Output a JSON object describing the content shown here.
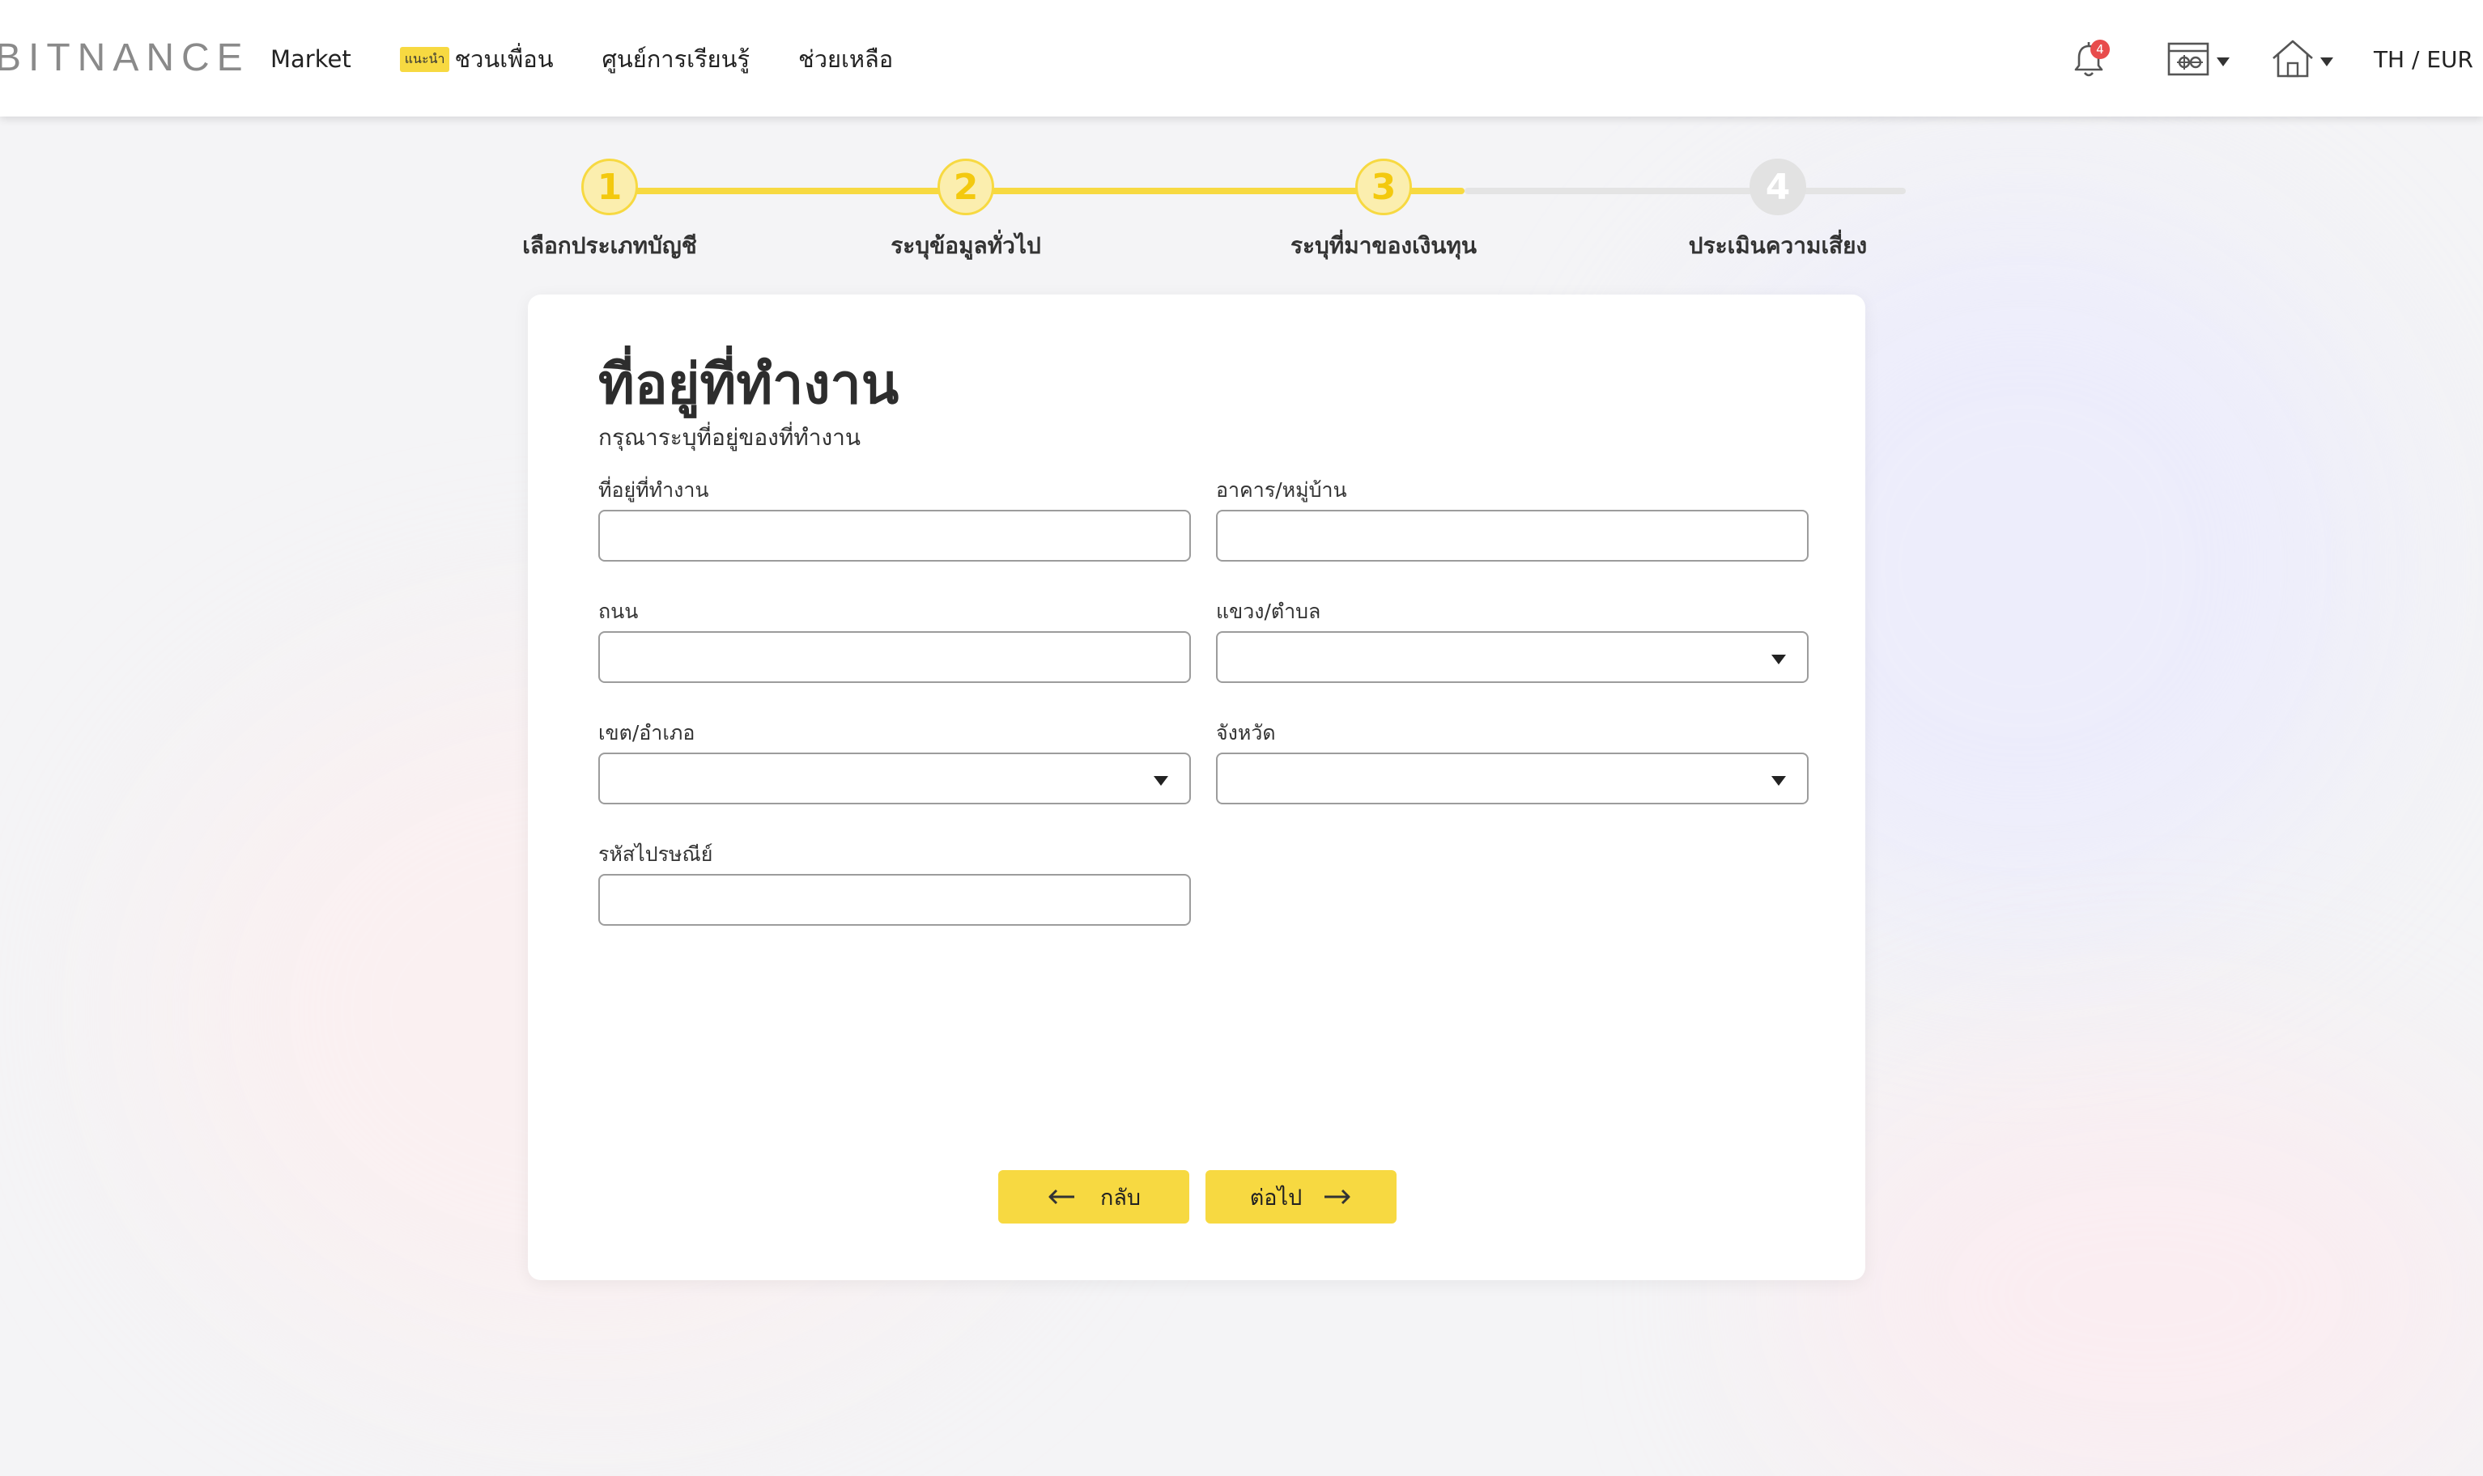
{
  "header": {
    "logo": "BITNANCE",
    "nav": [
      {
        "label": "Market"
      },
      {
        "badge": "แนะนำ",
        "label": "ชวนเพื่อน"
      },
      {
        "label": "ศูนย์การเรียนรู้"
      },
      {
        "label": "ช่วยเหลือ"
      }
    ],
    "notification_count": "4",
    "language_currency": "TH / EUR",
    "icons": [
      "bell-icon",
      "wallet-icon",
      "home-icon"
    ]
  },
  "stepper": {
    "active_color": "#f7d941",
    "inactive_color": "#e4e4e4",
    "current_step": 3,
    "steps": [
      {
        "number": "1",
        "label": "เลือกประเภทบัญชี",
        "state": "completed"
      },
      {
        "number": "2",
        "label": "ระบุข้อมูลทั่วไป",
        "state": "completed"
      },
      {
        "number": "3",
        "label": "ระบุที่มาของเงินทุน",
        "state": "current"
      },
      {
        "number": "4",
        "label": "ประเมินความเสี่ยง",
        "state": "pending"
      }
    ]
  },
  "form": {
    "title": "ที่อยู่ที่ทำงาน",
    "subtitle": "กรุณาระบุที่อยู่ของที่ทำงาน",
    "fields": {
      "work_address": {
        "label": "ที่อยู่ที่ทำงาน",
        "value": ""
      },
      "building_village": {
        "label": "อาคาร/หมู่บ้าน",
        "value": ""
      },
      "road": {
        "label": "ถนน",
        "value": ""
      },
      "subdistrict": {
        "label": "แขวง/ตำบล",
        "value": ""
      },
      "district": {
        "label": "เขต/อำเภอ",
        "value": ""
      },
      "province": {
        "label": "จังหวัด",
        "value": ""
      },
      "postal_code": {
        "label": "รหัสไปรษณีย์",
        "value": ""
      }
    },
    "buttons": {
      "back": "กลับ",
      "next": "ต่อไป"
    },
    "button_color": "#f7d941"
  }
}
